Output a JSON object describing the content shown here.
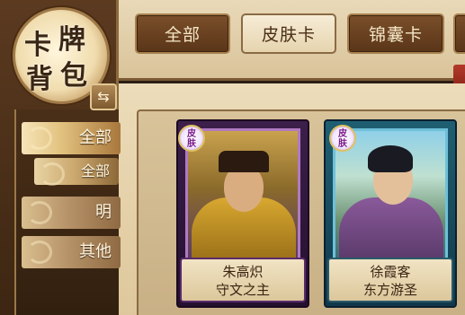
{
  "category_tabs": [
    {
      "label": "全部",
      "state": "dark"
    },
    {
      "label": "皮肤卡",
      "state": "selected"
    },
    {
      "label": "锦囊卡",
      "state": "dark"
    }
  ],
  "emblem": {
    "chars": [
      "卡",
      "牌",
      "背",
      "包"
    ],
    "swap_icon": "⇆"
  },
  "sidebar": {
    "items": [
      {
        "label": "全部",
        "active": true
      },
      {
        "label": "全部",
        "sub": true
      },
      {
        "label": "明"
      },
      {
        "label": "其他"
      }
    ]
  },
  "cards": [
    {
      "badge": [
        "皮",
        "肤"
      ],
      "name": "朱高炽",
      "title": "守文之主",
      "frame_color": "#3c1f4a"
    },
    {
      "badge": [
        "皮",
        "肤"
      ],
      "name": "徐霞客",
      "title": "东方游圣",
      "frame_color": "#1f5f72"
    }
  ]
}
